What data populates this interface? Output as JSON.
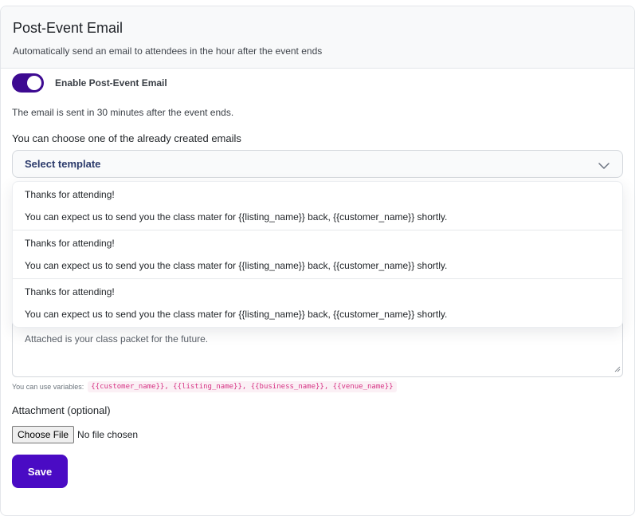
{
  "header": {
    "title": "Post-Event Email",
    "subtitle": "Automatically send an email to attendees in the hour after the event ends"
  },
  "toggle": {
    "label": "Enable Post-Event Email",
    "enabled": true
  },
  "info_text": "The email is sent in 30 minutes after the event ends.",
  "template": {
    "choose_label": "You can choose one of the already created emails",
    "selected": "Select template",
    "options": [
      {
        "title": "Thanks for attending!",
        "body": "You can expect us to send you the class mater for {{listing_name}} back, {{customer_name}} shortly."
      },
      {
        "title": "Thanks for attending!",
        "body": "You can expect us to send you the class mater for {{listing_name}} back, {{customer_name}} shortly."
      },
      {
        "title": "Thanks for attending!",
        "body": "You can expect us to send you the class mater for {{listing_name}} back, {{customer_name}} shortly."
      }
    ]
  },
  "message_body": "Attached is your class packet for the future.",
  "variables": {
    "label": "You can use variables:",
    "list": "{{customer_name}}, {{listing_name}}, {{business_name}}, {{venue_name}}"
  },
  "attachment": {
    "label": "Attachment (optional)",
    "button": "Choose File",
    "status": "No file chosen"
  },
  "save_label": "Save",
  "colors": {
    "accent": "#3d0a91",
    "save_button": "#4a0bc4",
    "variable_code": "#d63384"
  }
}
